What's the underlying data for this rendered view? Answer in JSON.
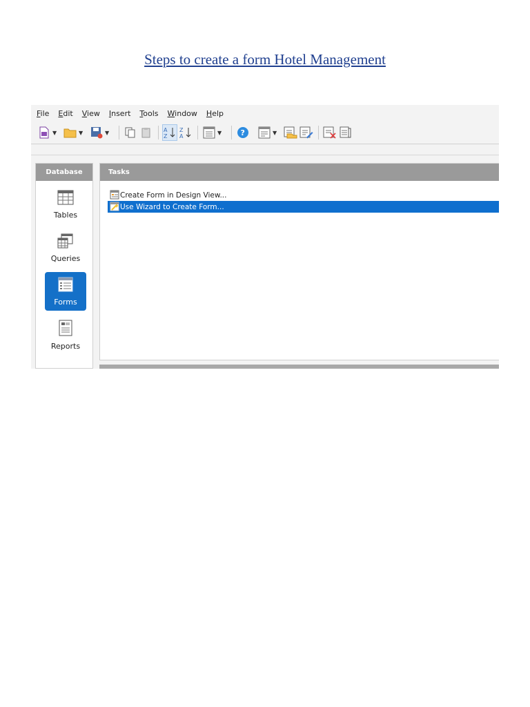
{
  "document": {
    "title": "Steps to create a form Hotel Management"
  },
  "menu": {
    "items": [
      {
        "u": "F",
        "rest": "ile"
      },
      {
        "u": "E",
        "rest": "dit"
      },
      {
        "u": "V",
        "rest": "iew"
      },
      {
        "u": "I",
        "rest": "nsert"
      },
      {
        "u": "T",
        "rest": "ools"
      },
      {
        "u": "W",
        "rest": "indow"
      },
      {
        "u": "H",
        "rest": "elp"
      }
    ]
  },
  "toolbar": {
    "icons": [
      "new-document-icon",
      "open-folder-icon",
      "save-icon",
      "copy-icon",
      "paste-icon",
      "sort-ascending-icon",
      "sort-descending-icon",
      "form-view-icon",
      "help-icon",
      "new-form-icon",
      "open-form-icon",
      "edit-form-icon",
      "delete-form-icon",
      "rename-form-icon"
    ],
    "accent_color": "#1470c8"
  },
  "database_panel": {
    "header": "Database",
    "items": [
      {
        "label": "Tables",
        "icon": "table-icon",
        "selected": false
      },
      {
        "label": "Queries",
        "icon": "queries-icon",
        "selected": false
      },
      {
        "label": "Forms",
        "icon": "forms-icon",
        "selected": true
      },
      {
        "label": "Reports",
        "icon": "reports-icon",
        "selected": false
      }
    ]
  },
  "tasks_panel": {
    "header": "Tasks",
    "items": [
      {
        "label": "Create Form in Design View...",
        "icon": "design-view-icon",
        "selected": false
      },
      {
        "label": "Use Wizard to Create Form...",
        "icon": "wizard-icon",
        "selected": true
      }
    ],
    "selection_color": "#0f6fce"
  }
}
